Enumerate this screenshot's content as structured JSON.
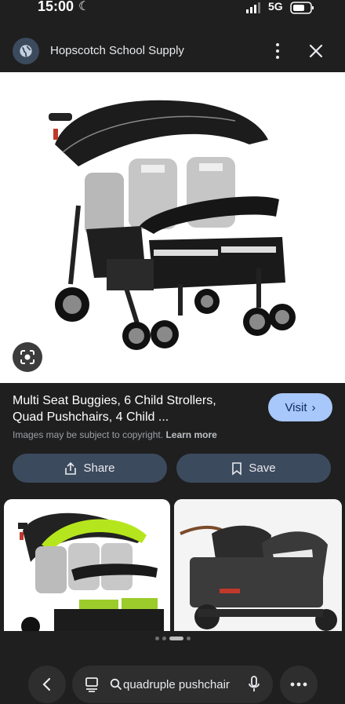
{
  "status": {
    "time": "15:00",
    "network": "5G"
  },
  "header": {
    "title": "Hopscotch School Supply"
  },
  "result": {
    "title_line1": "Multi Seat Buggies, 6 Child Strollers,",
    "title_line2": "Quad Pushchairs, 4 Child ...",
    "visit_label": "Visit",
    "copyright_text": "Images may be subject to copyright.",
    "learn_more": "Learn more"
  },
  "actions": {
    "share_label": "Share",
    "save_label": "Save"
  },
  "search": {
    "query": "quadruple pushchair"
  },
  "icons": [
    "globe-icon",
    "more-vert-icon",
    "close-icon",
    "lens-icon",
    "share-icon",
    "bookmark-icon",
    "back-icon",
    "tab-icon",
    "search-icon",
    "mic-icon",
    "more-horiz-icon"
  ]
}
